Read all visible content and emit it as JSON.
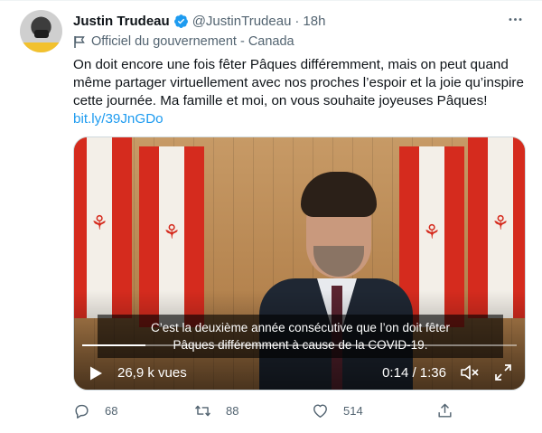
{
  "author": {
    "name": "Justin Trudeau",
    "handle": "@JustinTrudeau",
    "separator": "·",
    "time": "18h",
    "verified": true
  },
  "label": {
    "text": "Officiel du gouvernement - Canada",
    "icon": "flag-icon"
  },
  "tweet": {
    "text": "On doit encore une fois fêter Pâques différemment, mais on peut quand même partager virtuellement avec nos proches l’espoir et la joie qu’inspire cette journée. Ma famille et moi, on vous souhaite joyeuses Pâques!",
    "link": "bit.ly/39JnGDo"
  },
  "video": {
    "caption_line1": "C’est la deuxième année consécutive que l’on doit fêter",
    "caption_line2": "Pâques différemment à cause de la COVID-19.",
    "views": "26,9 k vues",
    "time": "0:14 / 1:36",
    "progress": 0.146
  },
  "actions": {
    "replies": "68",
    "retweets": "88",
    "likes": "514"
  },
  "colors": {
    "link": "#1d9bf0",
    "secondary": "#536471",
    "verified": "#1d9bf0"
  }
}
